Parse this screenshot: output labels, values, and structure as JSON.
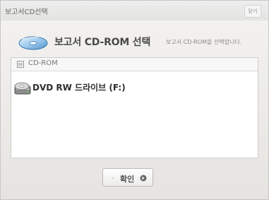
{
  "window": {
    "title": "보고서CD선택",
    "close_label": "닫기"
  },
  "header": {
    "title": "보고서 CD-ROM 선택",
    "description": "보고서 CD-ROM을 선택합니다."
  },
  "list": {
    "header": "CD-ROM",
    "items": [
      {
        "label": "DVD RW 드라이브 (F:)",
        "icon": "dvd-drive-icon"
      }
    ]
  },
  "footer": {
    "dash": "-",
    "ok_label": "확인"
  },
  "colors": {
    "window_bg": "#e9e7e4",
    "list_bg": "#ffffff",
    "border": "#cfcdca"
  }
}
